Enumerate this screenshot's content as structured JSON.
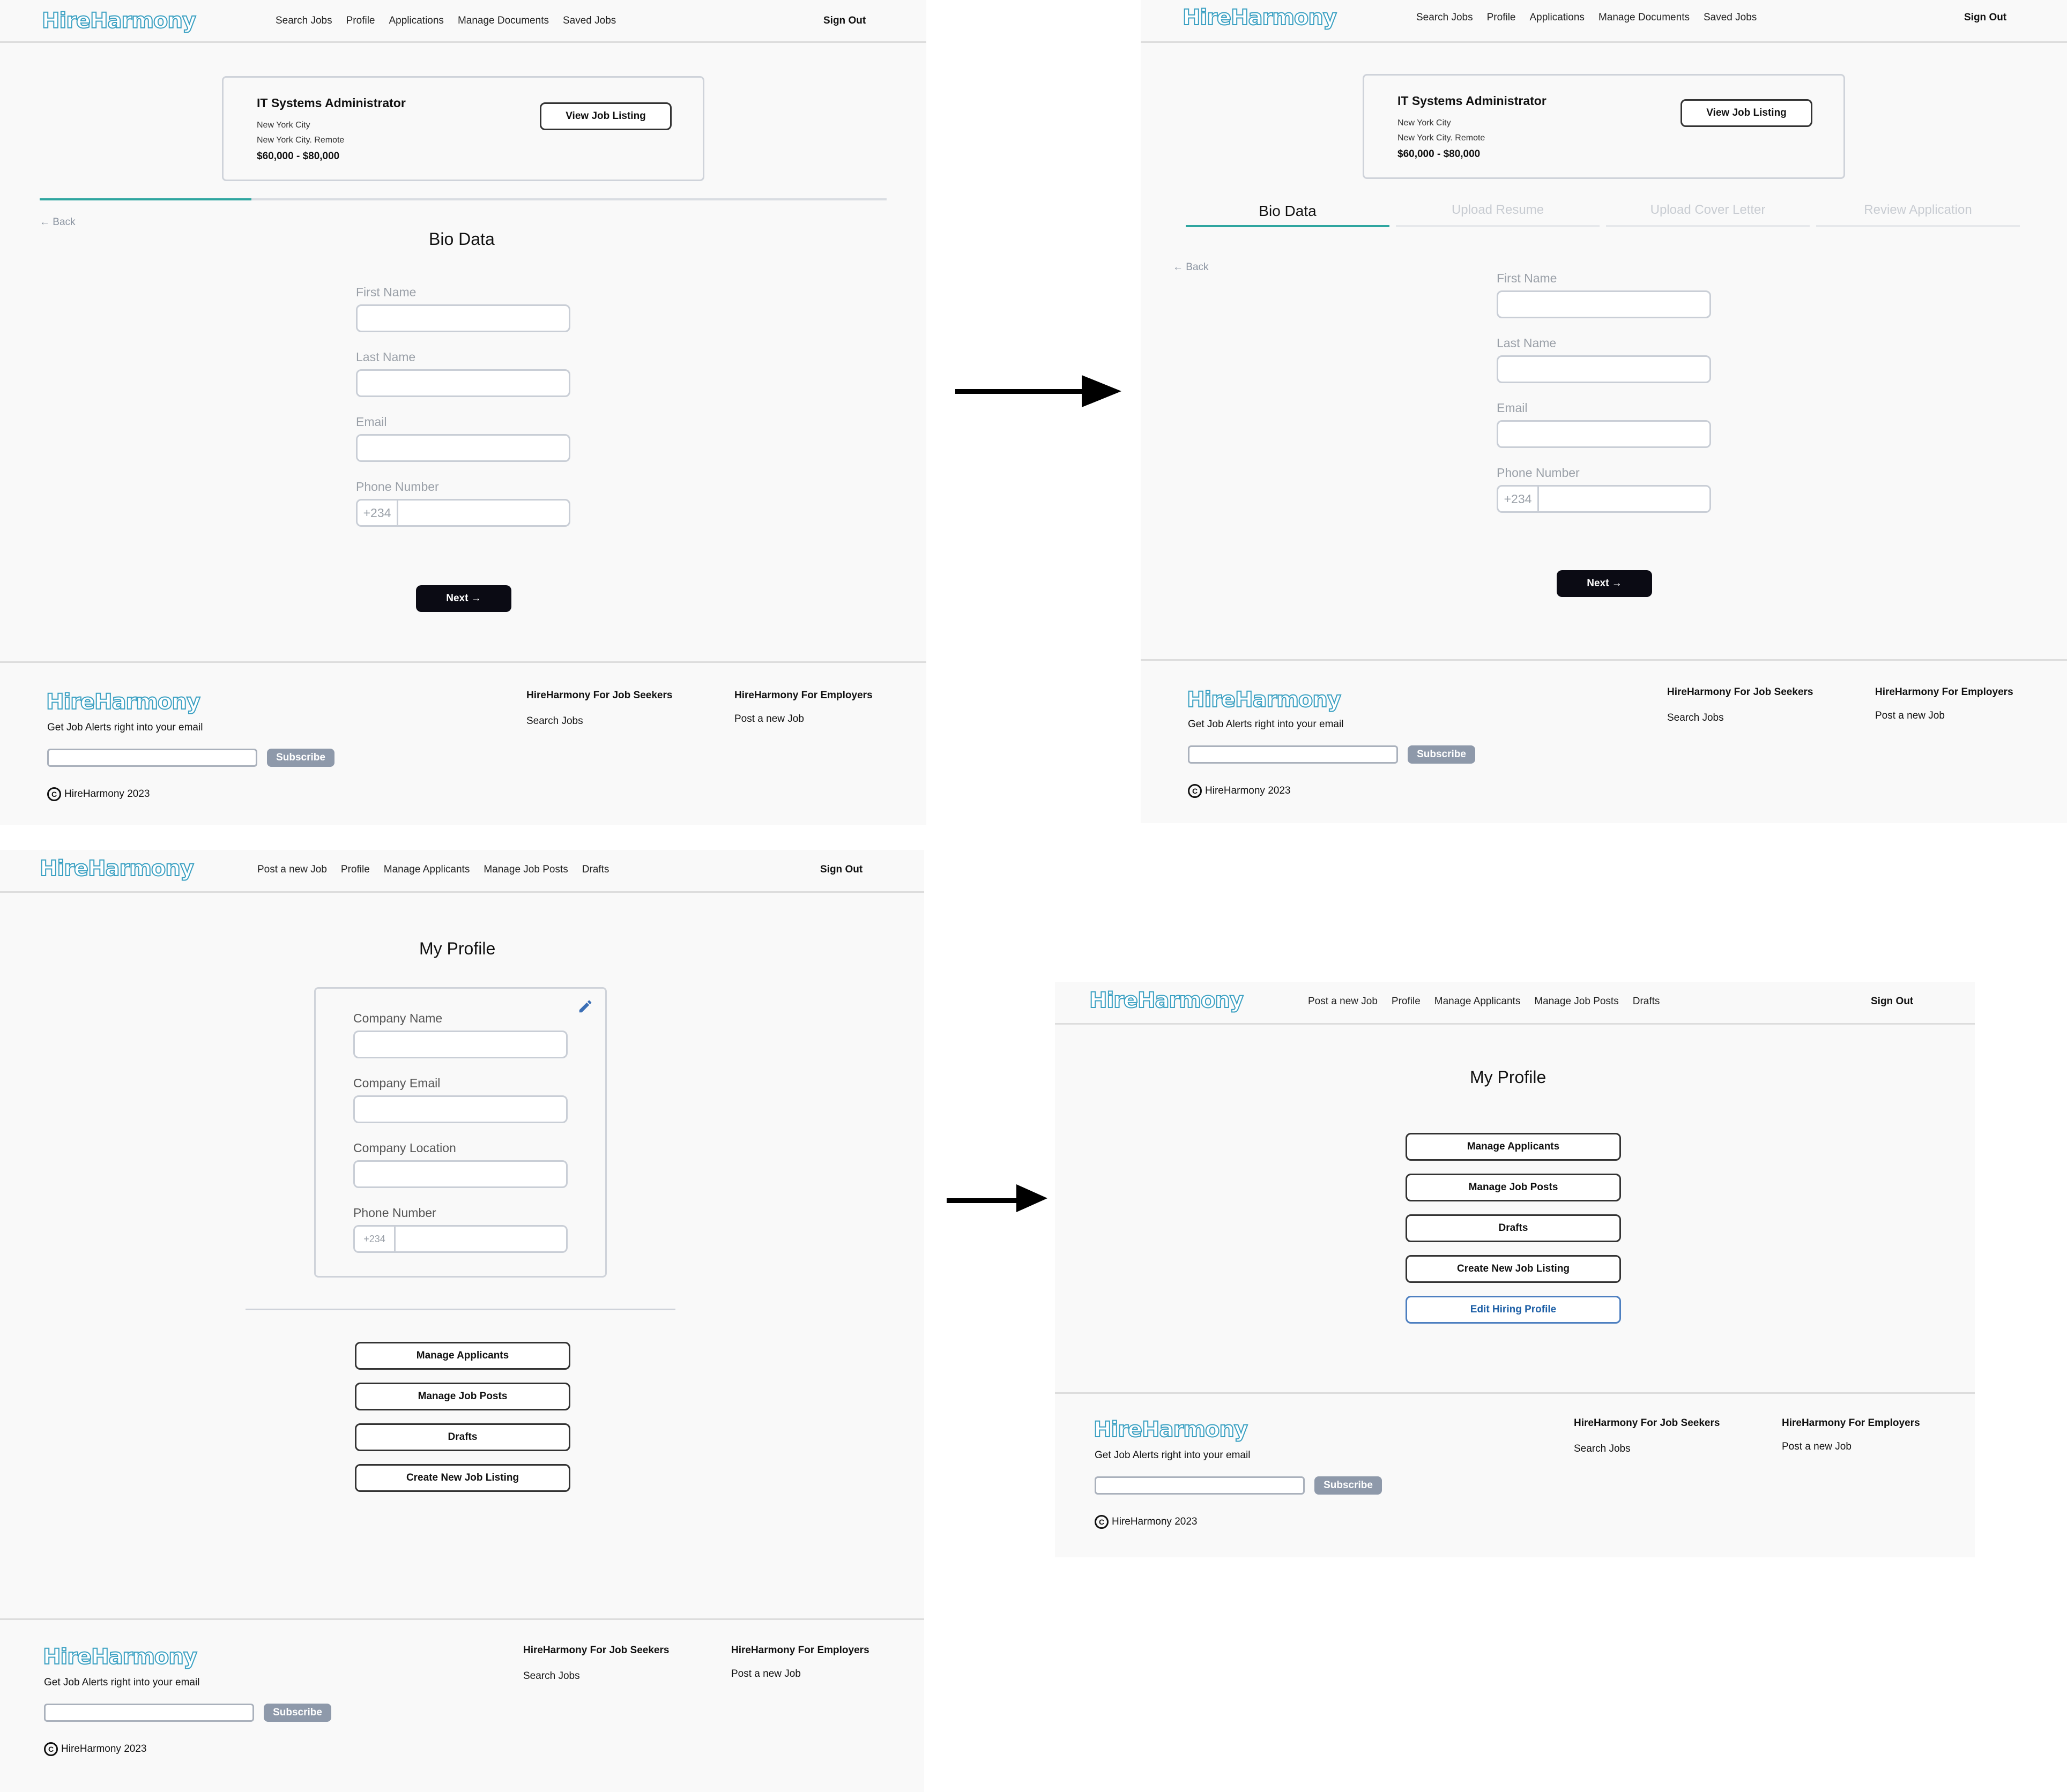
{
  "brand": {
    "logo_text": "HireHarmony",
    "accent": "#2fa6a0",
    "logo_color": "#3aa0c2"
  },
  "seeker_nav": {
    "links": [
      "Search Jobs",
      "Profile",
      "Applications",
      "Manage Documents",
      "Saved Jobs"
    ],
    "sign_out": "Sign Out"
  },
  "employer_nav": {
    "links": [
      "Post a new Job",
      "Profile",
      "Manage Applicants",
      "Manage Job Posts",
      "Drafts"
    ],
    "sign_out": "Sign Out"
  },
  "job_card": {
    "title": "IT Systems Administrator",
    "location": "New York City",
    "location_detail": "New York City. Remote",
    "salary": "$60,000 - $80,000",
    "view_button": "View Job Listing"
  },
  "application_form": {
    "back_label": "← Back",
    "section_title": "Bio Data",
    "progress_fraction": 0.25,
    "fields": {
      "first_name": "First Name",
      "last_name": "Last Name",
      "email": "Email",
      "phone": "Phone Number",
      "phone_prefix": "+234"
    },
    "next_button": "Next →",
    "steps": [
      "Bio Data",
      "Upload Resume",
      "Upload Cover Letter",
      "Review Application"
    ],
    "active_step": 0
  },
  "profile_page": {
    "title": "My Profile",
    "fields": {
      "company_name": "Company Name",
      "company_email": "Company Email",
      "company_location": "Company Location",
      "phone": "Phone Number",
      "phone_prefix": "+234"
    },
    "actions": [
      "Manage Applicants",
      "Manage Job Posts",
      "Drafts",
      "Create New Job Listing"
    ],
    "edit_profile_button": "Edit Hiring Profile"
  },
  "footer": {
    "alert_text": "Get Job Alerts right into your email",
    "subscribe": "Subscribe",
    "copyright": "HireHarmony 2023",
    "copyright_symbol": "C",
    "seekers_heading": "HireHarmony For Job Seekers",
    "seekers_link": "Search Jobs",
    "employers_heading": "HireHarmony For Employers",
    "employers_link": "Post a new Job"
  }
}
